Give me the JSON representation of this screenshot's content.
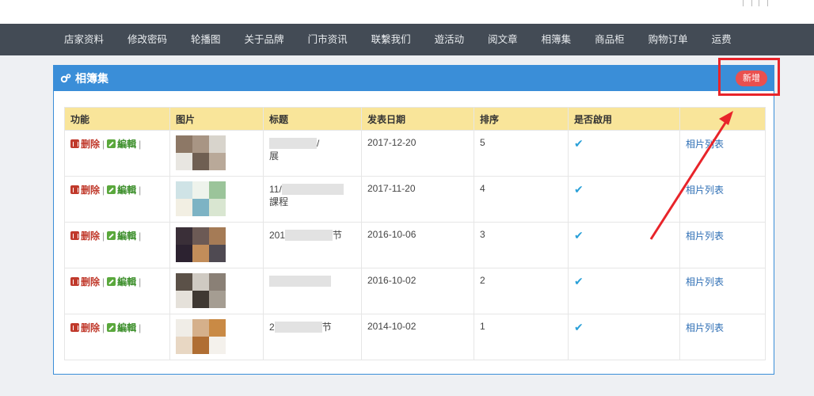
{
  "nav": {
    "items": [
      "店家资料",
      "修改密码",
      "轮播图",
      "关于品牌",
      "门市资讯",
      "联繫我们",
      "遊活动",
      "阅文章",
      "相簿集",
      "商品柜",
      "购物订单",
      "运费"
    ]
  },
  "panel": {
    "title": "相簿集",
    "new_button": "新增"
  },
  "table": {
    "headers": [
      "功能",
      "图片",
      "标题",
      "发表日期",
      "排序",
      "是否啟用",
      ""
    ],
    "delete_label": "删除",
    "edit_label": "編輯",
    "separator": "|",
    "enabled_mark": "✔",
    "list_link": "相片列表",
    "rows": [
      {
        "title_a": "",
        "title_b": "/",
        "title_c": "展",
        "date": "2017-12-20",
        "order": "5"
      },
      {
        "title_a": "11/",
        "title_b": "",
        "title_c": "課程",
        "date": "2017-11-20",
        "order": "4"
      },
      {
        "title_a": "201",
        "title_b": "节",
        "title_c": "",
        "date": "2016-10-06",
        "order": "3"
      },
      {
        "title_a": "",
        "title_b": "",
        "title_c": "",
        "date": "2016-10-02",
        "order": "2"
      },
      {
        "title_a": "2",
        "title_b": "节",
        "title_c": "",
        "date": "2014-10-02",
        "order": "1"
      }
    ]
  },
  "colors": {
    "nav_bg": "#434b55",
    "panel_header": "#3a8ed8",
    "table_header": "#f9e59a",
    "new_button": "#e9504f",
    "annotation_red": "#e8242a"
  }
}
